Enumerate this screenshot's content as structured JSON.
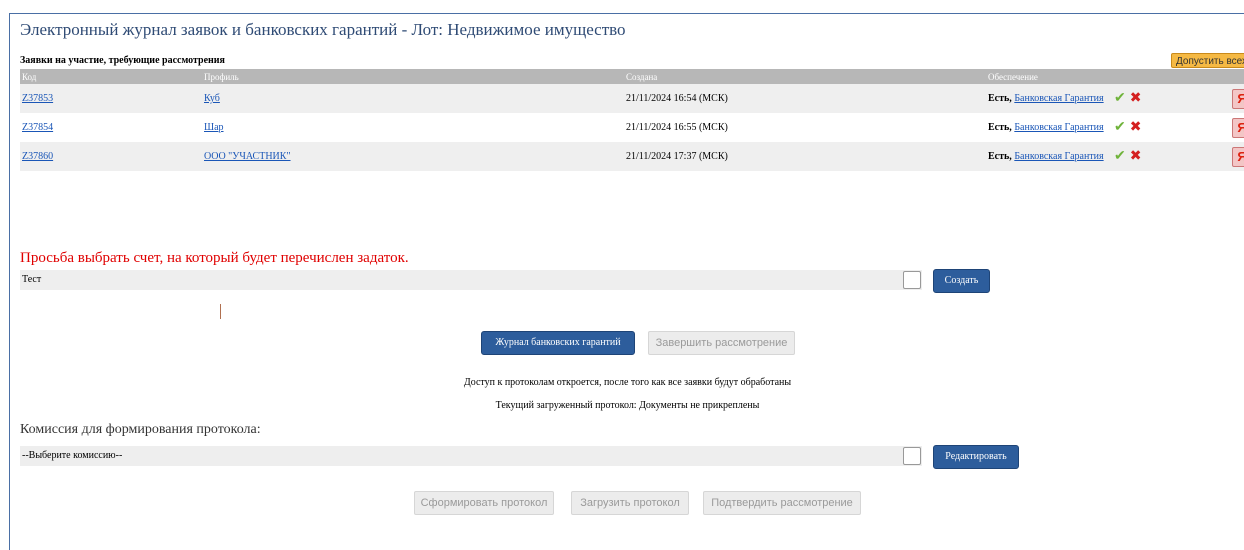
{
  "header": {
    "title": "Электронный журнал заявок и банковских гарантий - Лот: Недвижимое имущество"
  },
  "requests": {
    "section_label": "Заявки на участие, требующие рассмотрения",
    "approve_all_label": "Допустить всех",
    "columns": [
      "Код",
      "Профиль",
      "Создана",
      "Обеспечение"
    ],
    "rows": [
      {
        "code": "Z37853",
        "profile": "Куб",
        "created": "21/11/2024 16:54 (МСК)",
        "security_prefix": "Есть,",
        "security_link": "Банковская Гарантия"
      },
      {
        "code": "Z37854",
        "profile": "Шар",
        "created": "21/11/2024 16:55 (МСК)",
        "security_prefix": "Есть,",
        "security_link": "Банковская Гарантия"
      },
      {
        "code": "Z37860",
        "profile": "ООО \"УЧАСТНИК\"",
        "created": "21/11/2024 17:37 (МСК)",
        "security_prefix": "Есть,",
        "security_link": "Банковская Гарантия"
      }
    ],
    "approve_icon": "checkmark-icon",
    "reject_icon": "cross-icon",
    "profile_icon": "profile-icon"
  },
  "account": {
    "notice": "Просьба выбрать счет, на который будет перечислен задаток.",
    "selected": "Тест",
    "create_label": "Создать"
  },
  "actions": {
    "journal_label": "Журнал банковских гарантий",
    "finish_label": "Завершить рассмотрение"
  },
  "info": {
    "access_note": "Доступ к протоколам откроется, после того как все заявки будут обработаны",
    "current_protocol": "Текущий загруженный протокол: Документы не прикреплены"
  },
  "commission": {
    "label": "Комиссия для формирования протокола:",
    "selected": "--Выберите комиссию--",
    "edit_label": "Редактировать"
  },
  "protocol": {
    "generate_label": "Сформировать протокол",
    "upload_label": "Загрузить протокол",
    "confirm_label": "Подтвердить рассмотрение"
  },
  "colors": {
    "title": "#2f4b75",
    "notice": "#e00000",
    "primary_button": "#2d5d9c",
    "approve_all": "#f5b944",
    "header_row": "#b7b7b7"
  }
}
